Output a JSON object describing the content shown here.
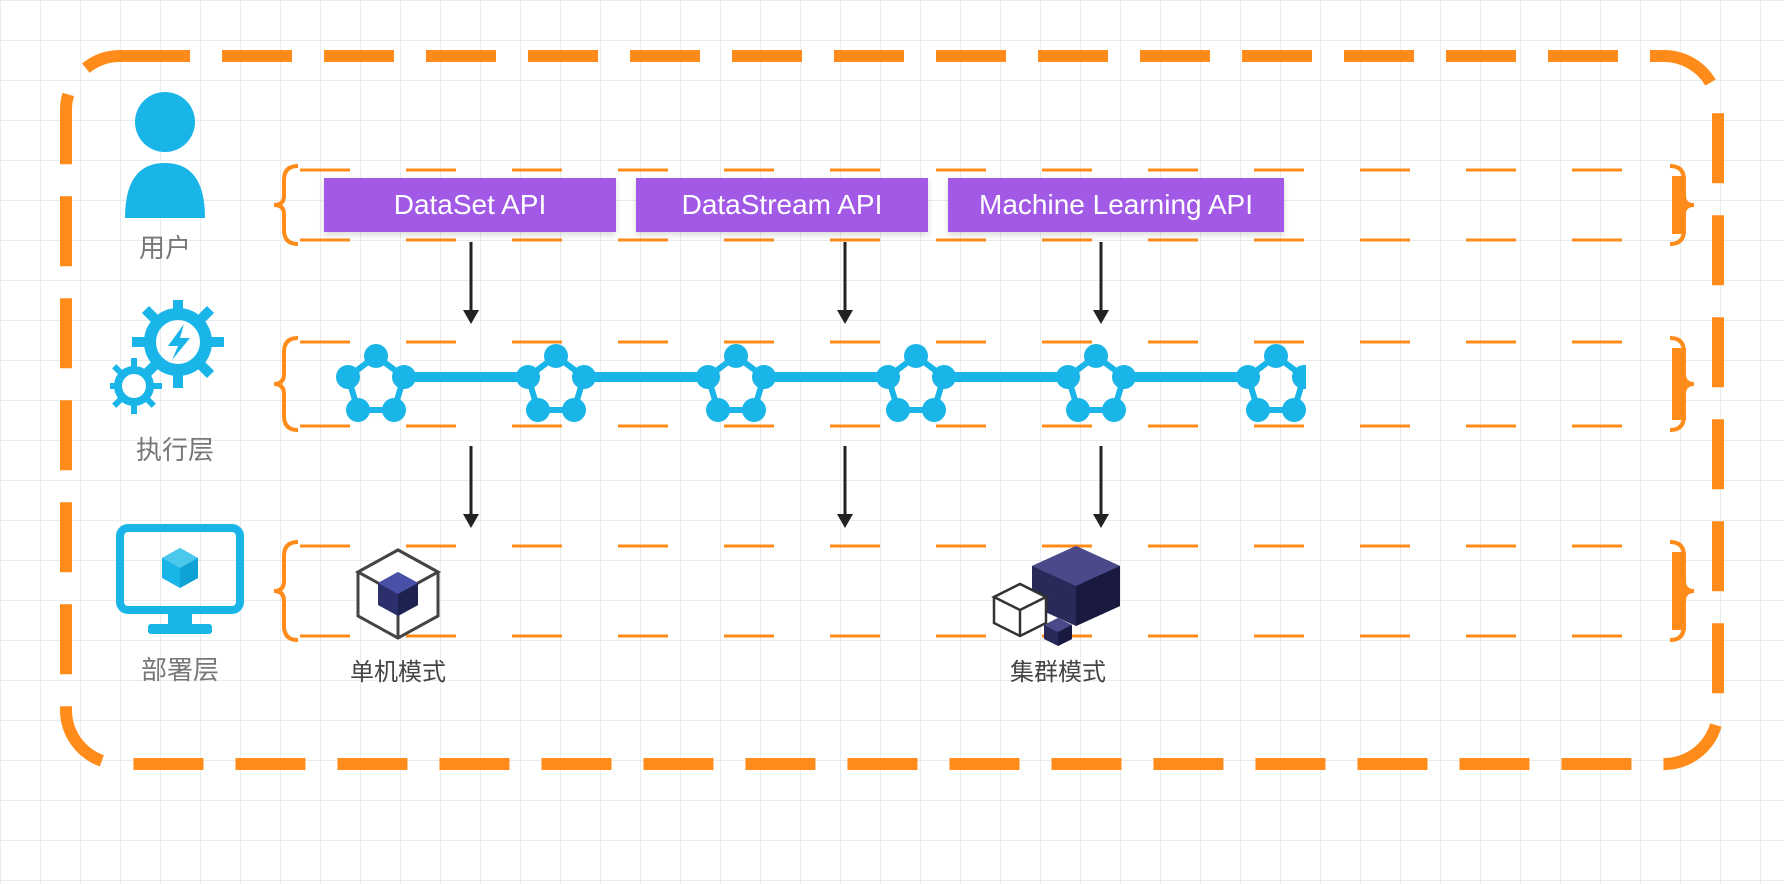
{
  "layers": {
    "user": {
      "label": "用户",
      "apis": [
        "DataSet API",
        "DataStream API",
        "Machine Learning API"
      ]
    },
    "execution": {
      "label": "执行层"
    },
    "deployment": {
      "label": "部署层",
      "modes": {
        "standalone": "单机模式",
        "cluster": "集群模式"
      }
    }
  },
  "colors": {
    "accent_orange": "#ff8c1a",
    "accent_blue": "#19b5e8",
    "api_purple": "#a259e6",
    "cube_navy": "#2b2f6b",
    "cube_small": "#2a2a5a"
  }
}
